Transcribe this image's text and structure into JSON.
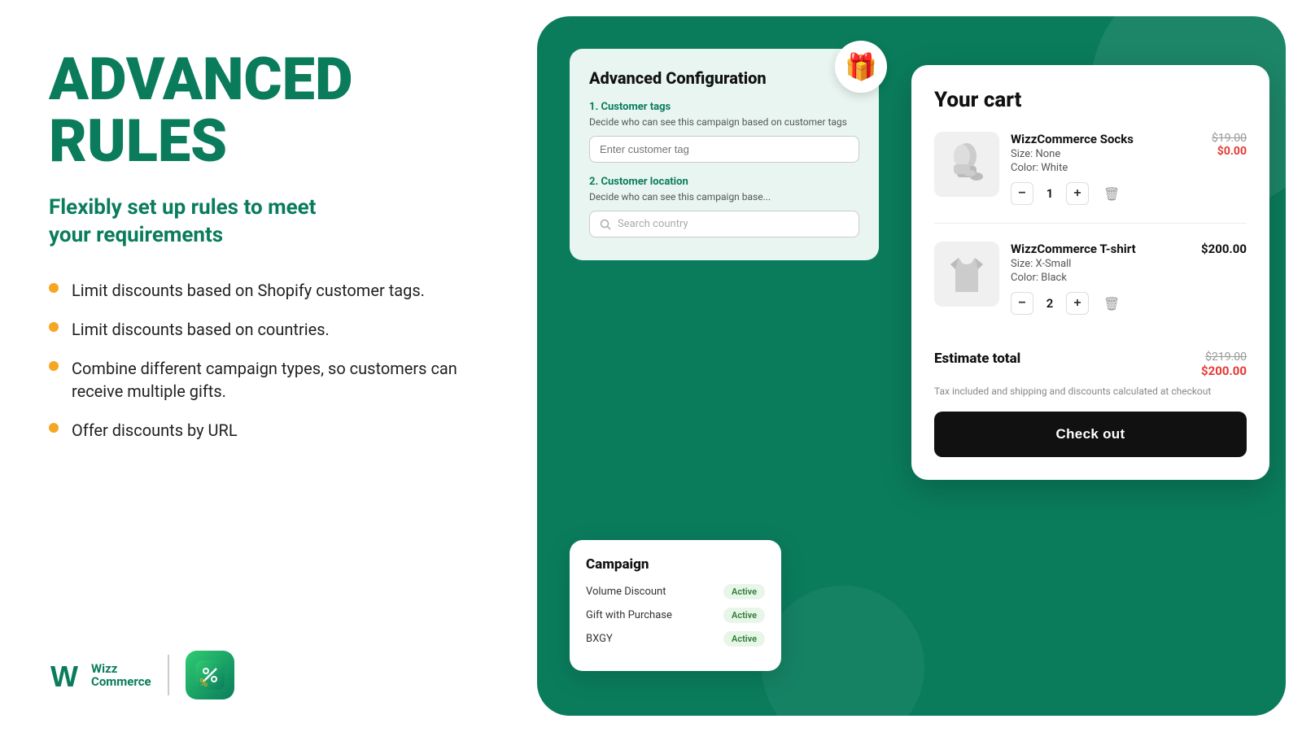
{
  "left": {
    "headline": "ADVANCED\nRULES",
    "subheadline": "Flexibly set up rules to meet\nyour requirements",
    "bullets": [
      "Limit discounts based on Shopify customer tags.",
      "Limit discounts based on countries.",
      "Combine different campaign types, so customers can receive multiple gifts.",
      "Offer discounts by URL"
    ],
    "logo_text_line1": "Wizz",
    "logo_text_line2": "Commerce"
  },
  "config_card": {
    "title": "Advanced Configuration",
    "section1_label": "1. Customer tags",
    "section1_desc": "Decide who can see this campaign based on customer tags",
    "section1_placeholder": "Enter customer tag",
    "section2_label": "2. Customer location",
    "section2_desc": "Decide who can see this campaign base...",
    "section2_placeholder": "Search country"
  },
  "campaign_card": {
    "title": "Campaign",
    "items": [
      {
        "name": "Volume Discount",
        "status": "Active"
      },
      {
        "name": "Gift with Purchase",
        "status": "Active"
      },
      {
        "name": "BXGY",
        "status": "Active"
      }
    ]
  },
  "cart": {
    "title": "Your cart",
    "items": [
      {
        "name": "WizzCommerce Socks",
        "size": "Size: None",
        "color": "Color: White",
        "price_original": "$19.00",
        "price_discount": "$0.00",
        "quantity": 1,
        "type": "socks"
      },
      {
        "name": "WizzCommerce T-shirt",
        "size": "Size: X-Small",
        "color": "Color: Black",
        "price_only": "$200.00",
        "quantity": 2,
        "type": "tshirt"
      }
    ],
    "estimate_label": "Estimate total",
    "estimate_original": "$219.00",
    "estimate_discount": "$200.00",
    "tax_note": "Tax included and shipping and discounts calculated at checkout",
    "checkout_label": "Check out"
  },
  "gift_emoji": "🎁"
}
